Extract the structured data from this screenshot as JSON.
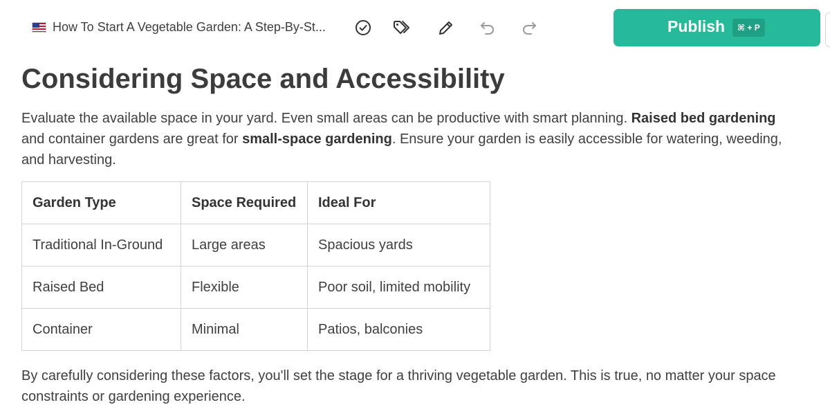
{
  "toolbar": {
    "flag_icon": "us-flag-icon",
    "document_title": "How To Start A Vegetable Garden: A Step-By-St...",
    "icons": [
      "check-circle-icon",
      "tags-icon",
      "pencil-icon",
      "undo-icon",
      "redo-icon"
    ],
    "publish_label": "Publish",
    "publish_shortcut": "⌘ + P",
    "accent_color": "#26b99a"
  },
  "article": {
    "heading": "Considering Space and Accessibility",
    "intro": {
      "text_1": "Evaluate the available space in your yard. Even small areas can be productive with smart planning. ",
      "bold_1": "Raised bed gardening",
      "text_2": " and container gardens are great for ",
      "bold_2": "small-space gardening",
      "text_3": ". Ensure your garden is easily accessible for watering, weeding, and harvesting."
    },
    "table": {
      "headers": [
        "Garden Type",
        "Space Required",
        "Ideal For"
      ],
      "rows": [
        [
          "Traditional In-Ground",
          "Large areas",
          "Spacious yards"
        ],
        [
          "Raised Bed",
          "Flexible",
          "Poor soil, limited mobility"
        ],
        [
          "Container",
          "Minimal",
          "Patios, balconies"
        ]
      ]
    },
    "conclusion": "By carefully considering these factors, you'll set the stage for a thriving vegetable garden. This is true, no matter your space constraints or gardening experience."
  }
}
